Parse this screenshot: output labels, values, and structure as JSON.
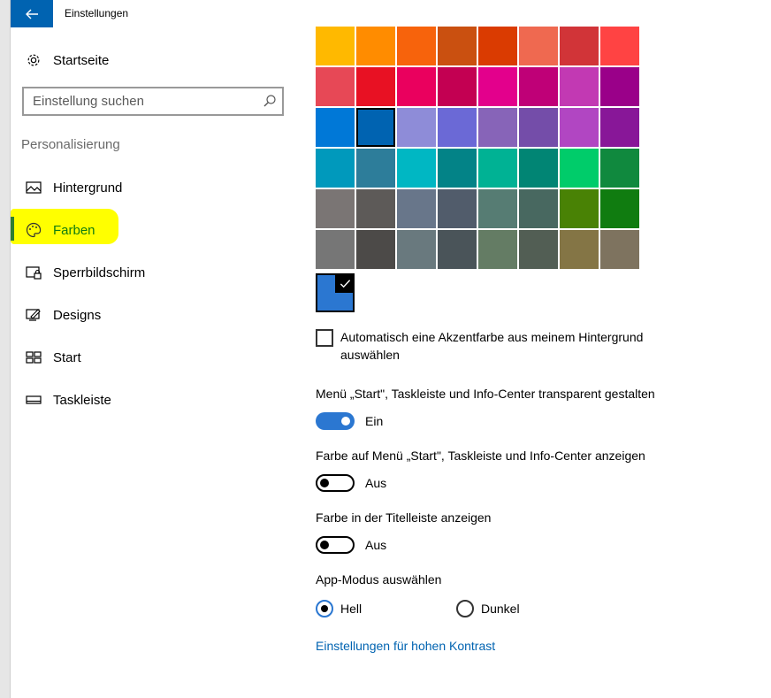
{
  "window": {
    "title": "Einstellungen",
    "back_icon": "back-arrow-icon"
  },
  "nav": {
    "home_label": "Startseite",
    "search_placeholder": "Einstellung suchen",
    "section_label": "Personalisierung",
    "items": [
      {
        "label": "Hintergrund",
        "icon": "picture-icon"
      },
      {
        "label": "Farben",
        "icon": "palette-icon",
        "selected": true
      },
      {
        "label": "Sperrbildschirm",
        "icon": "lock-screen-icon"
      },
      {
        "label": "Designs",
        "icon": "designs-icon"
      },
      {
        "label": "Start",
        "icon": "start-icon"
      },
      {
        "label": "Taskleiste",
        "icon": "taskbar-icon"
      }
    ]
  },
  "colors": {
    "accent": "#2b77d1",
    "swatches": [
      "#ffb900",
      "#ff8c00",
      "#f7630c",
      "#ca5010",
      "#da3b01",
      "#ef6950",
      "#d13438",
      "#ff4343",
      "#e74856",
      "#e81123",
      "#ea005e",
      "#c30052",
      "#e3008c",
      "#bf0077",
      "#c239b3",
      "#9a0089",
      "#0078d7",
      "#0063b1",
      "#8e8cd8",
      "#6b69d6",
      "#8764b8",
      "#744da9",
      "#b146c2",
      "#881798",
      "#0099bc",
      "#2d7d9a",
      "#00b7c3",
      "#038387",
      "#00b294",
      "#018574",
      "#00cc6a",
      "#10893e",
      "#7a7574",
      "#5d5a58",
      "#68768a",
      "#515c6b",
      "#567c73",
      "#486860",
      "#498205",
      "#107c10",
      "#767676",
      "#4c4a48",
      "#69797e",
      "#4a5459",
      "#647c64",
      "#525e54",
      "#847545",
      "#7e735f"
    ],
    "selected_index": 17
  },
  "settings": {
    "auto_accent_label": "Automatisch eine Akzentfarbe aus meinem Hintergrund auswählen",
    "transparency_label": "Menü „Start\", Taskleiste und Info-Center transparent gestalten",
    "transparency_state": "Ein",
    "color_start_label": "Farbe auf Menü „Start\", Taskleiste und Info-Center anzeigen",
    "color_start_state": "Aus",
    "color_titlebar_label": "Farbe in der Titelleiste anzeigen",
    "color_titlebar_state": "Aus",
    "app_mode_label": "App-Modus auswählen",
    "app_mode_light": "Hell",
    "app_mode_dark": "Dunkel",
    "high_contrast_link": "Einstellungen für hohen Kontrast"
  }
}
